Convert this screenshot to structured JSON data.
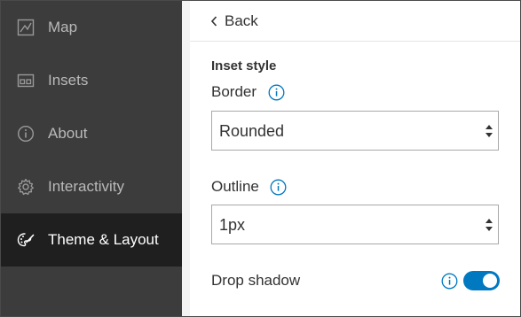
{
  "sidebar": {
    "items": [
      {
        "label": "Map",
        "icon": "map-icon",
        "active": false
      },
      {
        "label": "Insets",
        "icon": "insets-icon",
        "active": false
      },
      {
        "label": "About",
        "icon": "info-icon",
        "active": false
      },
      {
        "label": "Interactivity",
        "icon": "gear-icon",
        "active": false
      },
      {
        "label": "Theme & Layout",
        "icon": "palette-icon",
        "active": true
      }
    ]
  },
  "panel": {
    "back_label": "Back",
    "section_title": "Inset style",
    "border": {
      "label": "Border",
      "value": "Rounded"
    },
    "outline": {
      "label": "Outline",
      "value": "1px"
    },
    "drop_shadow": {
      "label": "Drop shadow",
      "enabled": true
    }
  },
  "colors": {
    "sidebar_bg": "#3c3c3c",
    "sidebar_active_bg": "#1f1f1f",
    "accent": "#0079c1"
  }
}
